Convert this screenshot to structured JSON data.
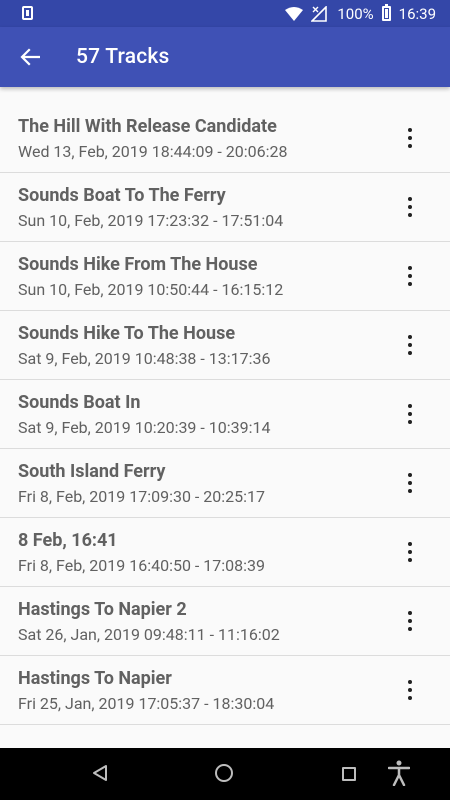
{
  "status_bar": {
    "battery_percent": "100%",
    "time": "16:39"
  },
  "app_bar": {
    "back_icon": "arrow-left-icon",
    "title": "57 Tracks"
  },
  "tracks": [
    {
      "title": "The Hill With Release Candidate",
      "subtitle": "Wed 13, Feb, 2019 18:44:09 - 20:06:28"
    },
    {
      "title": "Sounds Boat To The Ferry",
      "subtitle": "Sun 10, Feb, 2019 17:23:32 - 17:51:04"
    },
    {
      "title": "Sounds Hike From The House",
      "subtitle": "Sun 10, Feb, 2019 10:50:44 - 16:15:12"
    },
    {
      "title": "Sounds Hike To The House",
      "subtitle": "Sat 9, Feb, 2019 10:48:38 - 13:17:36"
    },
    {
      "title": "Sounds Boat In",
      "subtitle": "Sat 9, Feb, 2019 10:20:39 - 10:39:14"
    },
    {
      "title": "South Island Ferry",
      "subtitle": "Fri 8, Feb, 2019 17:09:30 - 20:25:17"
    },
    {
      "title": "8 Feb, 16:41",
      "subtitle": "Fri 8, Feb, 2019 16:40:50 - 17:08:39"
    },
    {
      "title": "Hastings To Napier 2",
      "subtitle": "Sat 26, Jan, 2019 09:48:11 - 11:16:02"
    },
    {
      "title": "Hastings To Napier",
      "subtitle": "Fri 25, Jan, 2019 17:05:37 - 18:30:04"
    }
  ],
  "colors": {
    "status_bar": "#3447a8",
    "app_bar": "#3f51b5",
    "text": "#616161"
  }
}
